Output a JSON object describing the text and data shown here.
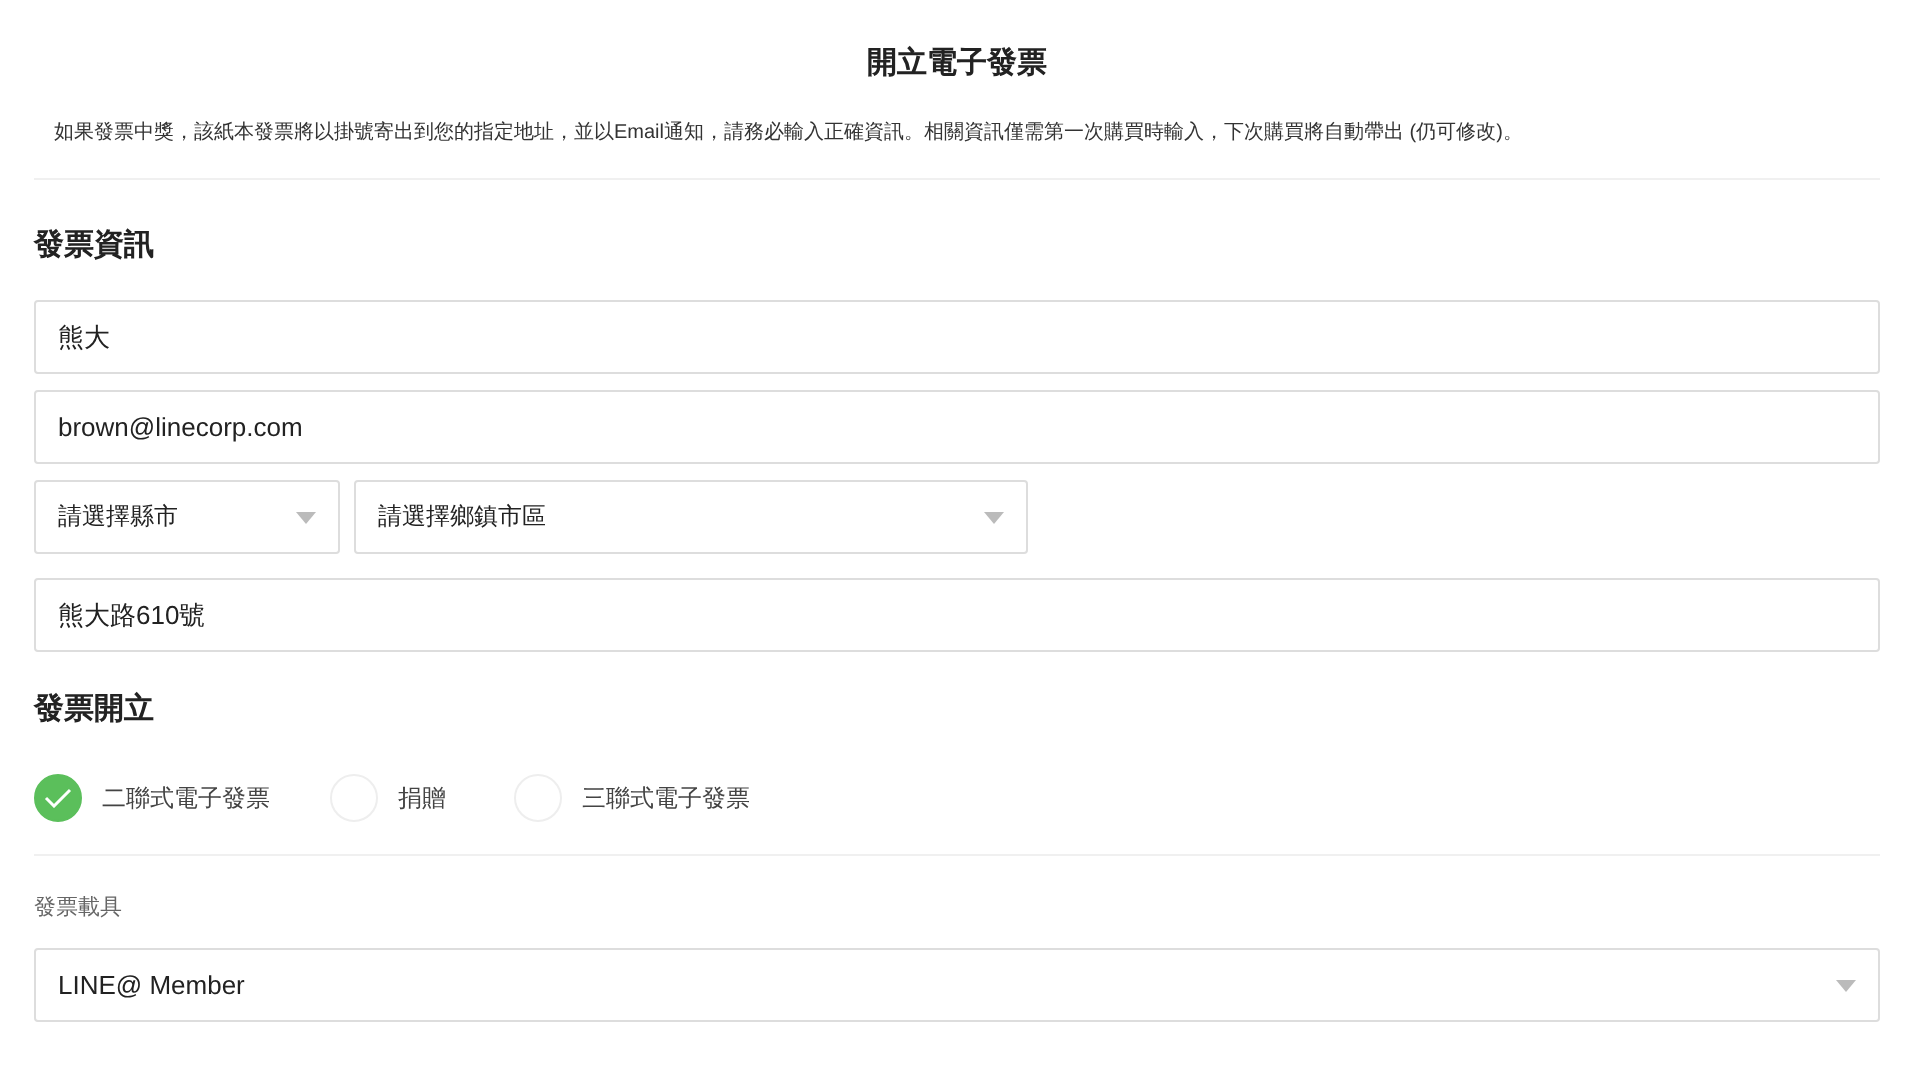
{
  "title": "開立電子發票",
  "notice": "如果發票中獎，該紙本發票將以掛號寄出到您的指定地址，並以Email通知，請務必輸入正確資訊。相關資訊僅需第一次購買時輸入，下次購買將自動帶出 (仍可修改)。",
  "info_section": {
    "heading": "發票資訊",
    "name_field": {
      "value": "熊大"
    },
    "email_field": {
      "value": "brown@linecorp.com"
    },
    "city_select": {
      "placeholder": "請選擇縣市"
    },
    "district_select": {
      "placeholder": "請選擇鄉鎮市區"
    },
    "address_field": {
      "value": "熊大路610號"
    }
  },
  "issue_section": {
    "heading": "發票開立",
    "options": [
      {
        "label": "二聯式電子發票",
        "selected": true
      },
      {
        "label": "捐贈",
        "selected": false
      },
      {
        "label": "三聯式電子發票",
        "selected": false
      }
    ]
  },
  "carrier": {
    "label": "發票載具",
    "select": {
      "value": "LINE@ Member"
    }
  }
}
